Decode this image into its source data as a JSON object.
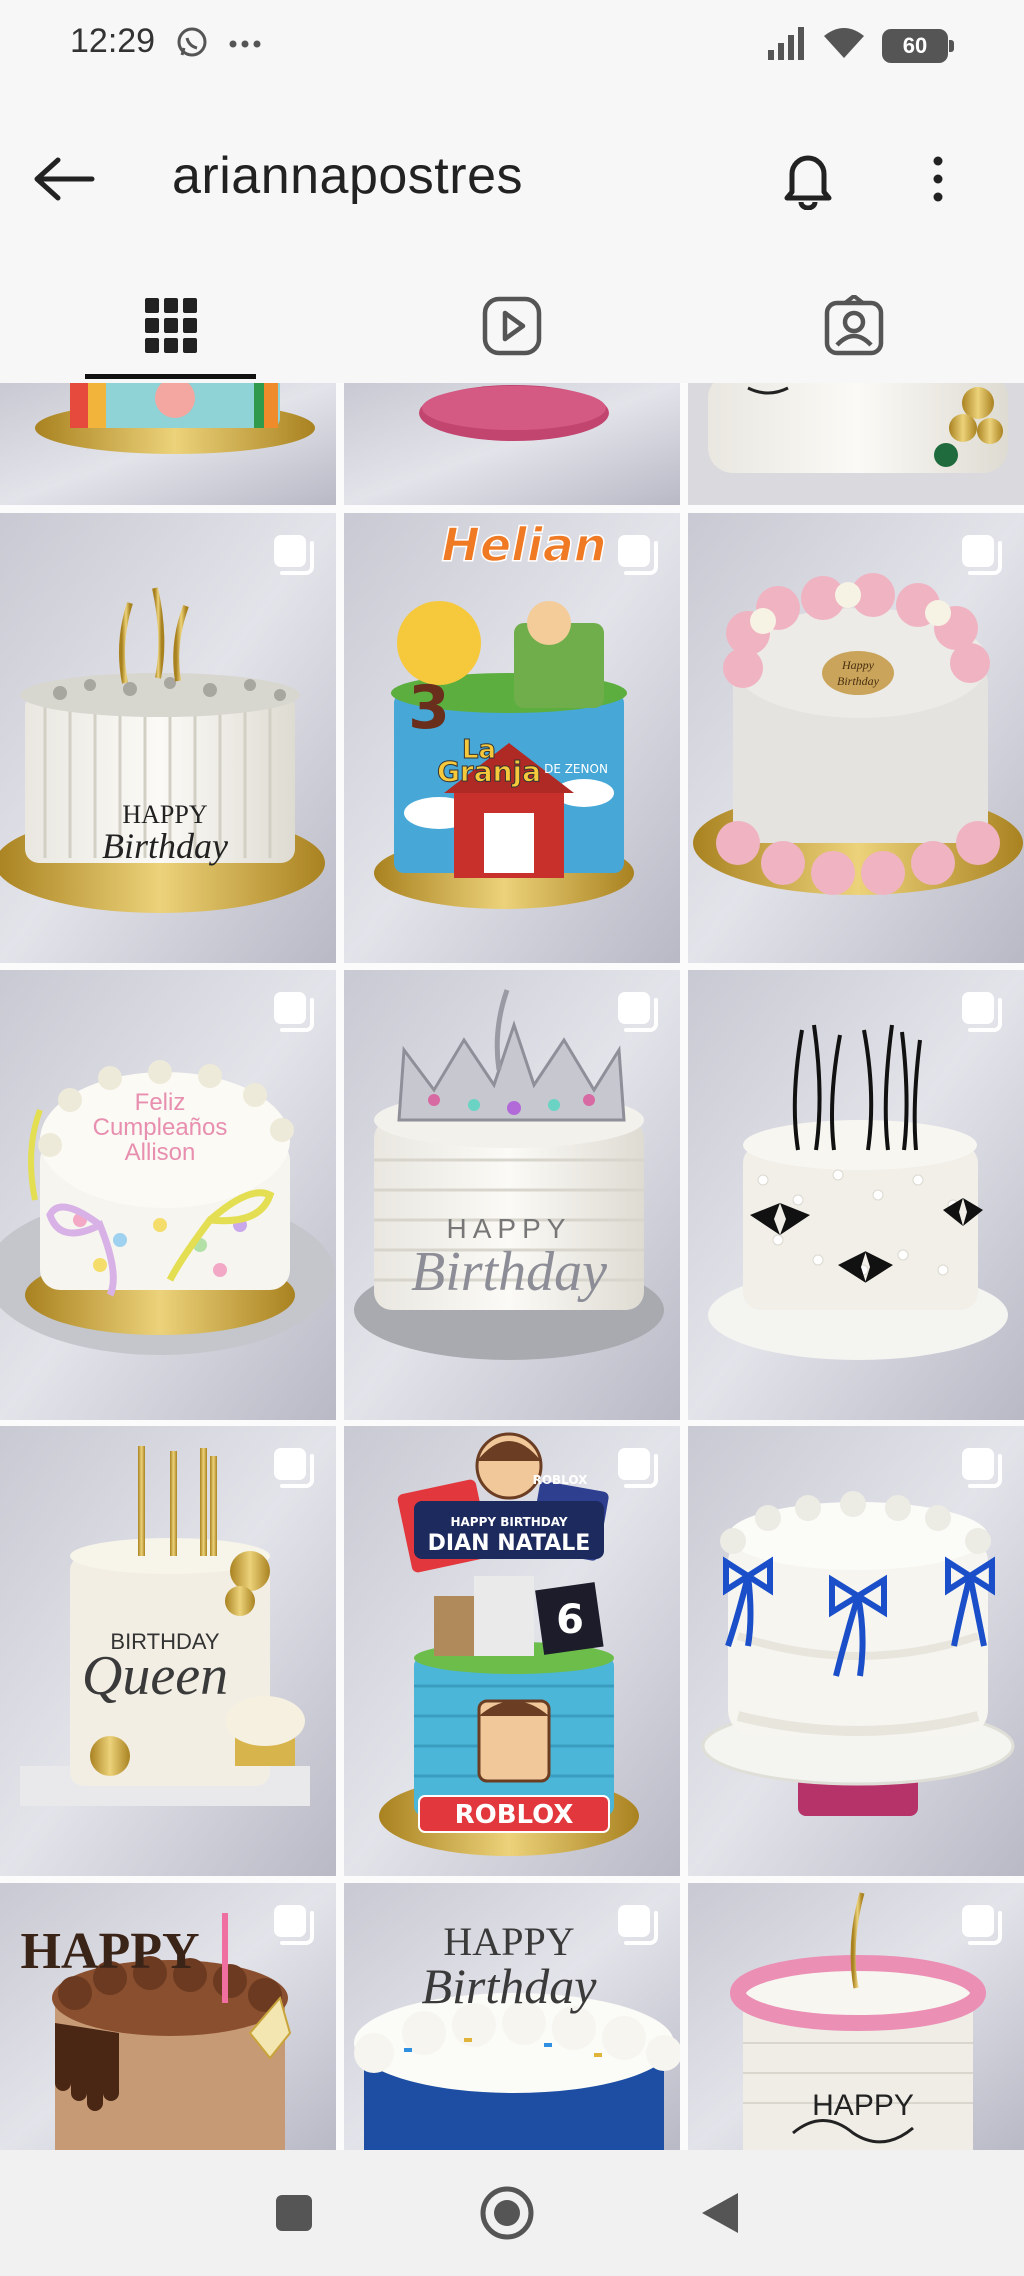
{
  "status_bar": {
    "time": "12:29",
    "battery": "60",
    "icons": [
      "whatsapp-icon",
      "more-dots-icon",
      "signal-icon",
      "wifi-icon",
      "battery-icon"
    ]
  },
  "header": {
    "title": "ariannapostres",
    "icons": [
      "back-arrow-icon",
      "bell-icon",
      "more-vertical-icon"
    ]
  },
  "tabs": [
    {
      "name": "grid",
      "icon": "grid-icon",
      "selected": true
    },
    {
      "name": "reels",
      "icon": "reels-icon",
      "selected": false
    },
    {
      "name": "tagged",
      "icon": "tagged-icon",
      "selected": false
    }
  ],
  "posts": [
    {
      "text_lines": [],
      "carousel": false
    },
    {
      "text_lines": [],
      "carousel": false
    },
    {
      "text_lines": [],
      "carousel": false
    },
    {
      "text_lines": [
        "HAPPY",
        "Birthday"
      ],
      "carousel": true
    },
    {
      "text_lines": [
        "Helian",
        "3",
        "La",
        "Granja",
        "DE ZENON"
      ],
      "carousel": true
    },
    {
      "text_lines": [
        "Happy",
        "Birthday"
      ],
      "carousel": true
    },
    {
      "text_lines": [
        "Feliz",
        "Cumpleaños",
        "Allison"
      ],
      "carousel": true
    },
    {
      "text_lines": [
        "HAPPY",
        "Birthday"
      ],
      "carousel": true
    },
    {
      "text_lines": [],
      "carousel": true
    },
    {
      "text_lines": [
        "BIRTHDAY",
        "Queen"
      ],
      "carousel": true
    },
    {
      "text_lines": [
        "ROBLOX",
        "HAPPY BIRTHDAY",
        "DIAN NATALE",
        "6",
        "ROBLOX"
      ],
      "carousel": true
    },
    {
      "text_lines": [],
      "carousel": true
    },
    {
      "text_lines": [
        "HAPPY"
      ],
      "carousel": true
    },
    {
      "text_lines": [
        "HAPPY",
        "Birthday"
      ],
      "carousel": true
    },
    {
      "text_lines": [
        "HAPPY"
      ],
      "carousel": true
    }
  ],
  "nav_bar": {
    "icons": [
      "recents-square-icon",
      "home-circle-icon",
      "back-triangle-icon"
    ]
  },
  "colors": {
    "background": "#fbfbfb",
    "bar": "#f7f7f7",
    "icon": "#222222",
    "marble": "#dcdde6",
    "gold": "#c9a43a"
  }
}
